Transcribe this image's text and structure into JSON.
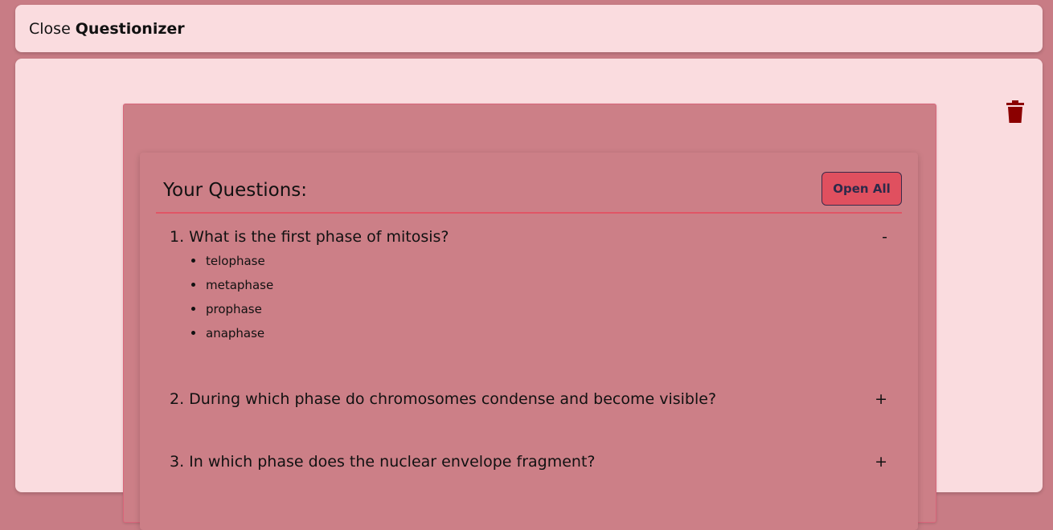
{
  "topbar": {
    "close_label": "Close",
    "app_name": "Questionizer"
  },
  "colors": {
    "background": "#c87c85",
    "panel": "#fadcdf",
    "quiz_box": "#cc7f87",
    "accent_button": "#e0505f",
    "trash_icon": "#8b0000"
  },
  "icons": {
    "trash": "trash-icon"
  },
  "questions_card": {
    "title": "Your Questions:",
    "open_all_label": "Open All",
    "questions": [
      {
        "text": "1. What is the first phase of mitosis?",
        "toggle": "-",
        "options": [
          "telophase",
          "metaphase",
          "prophase",
          "anaphase"
        ]
      },
      {
        "text": "2. During which phase do chromosomes condense and become visible?",
        "toggle": "+"
      },
      {
        "text": "3. In which phase does the nuclear envelope fragment?",
        "toggle": "+"
      }
    ]
  }
}
